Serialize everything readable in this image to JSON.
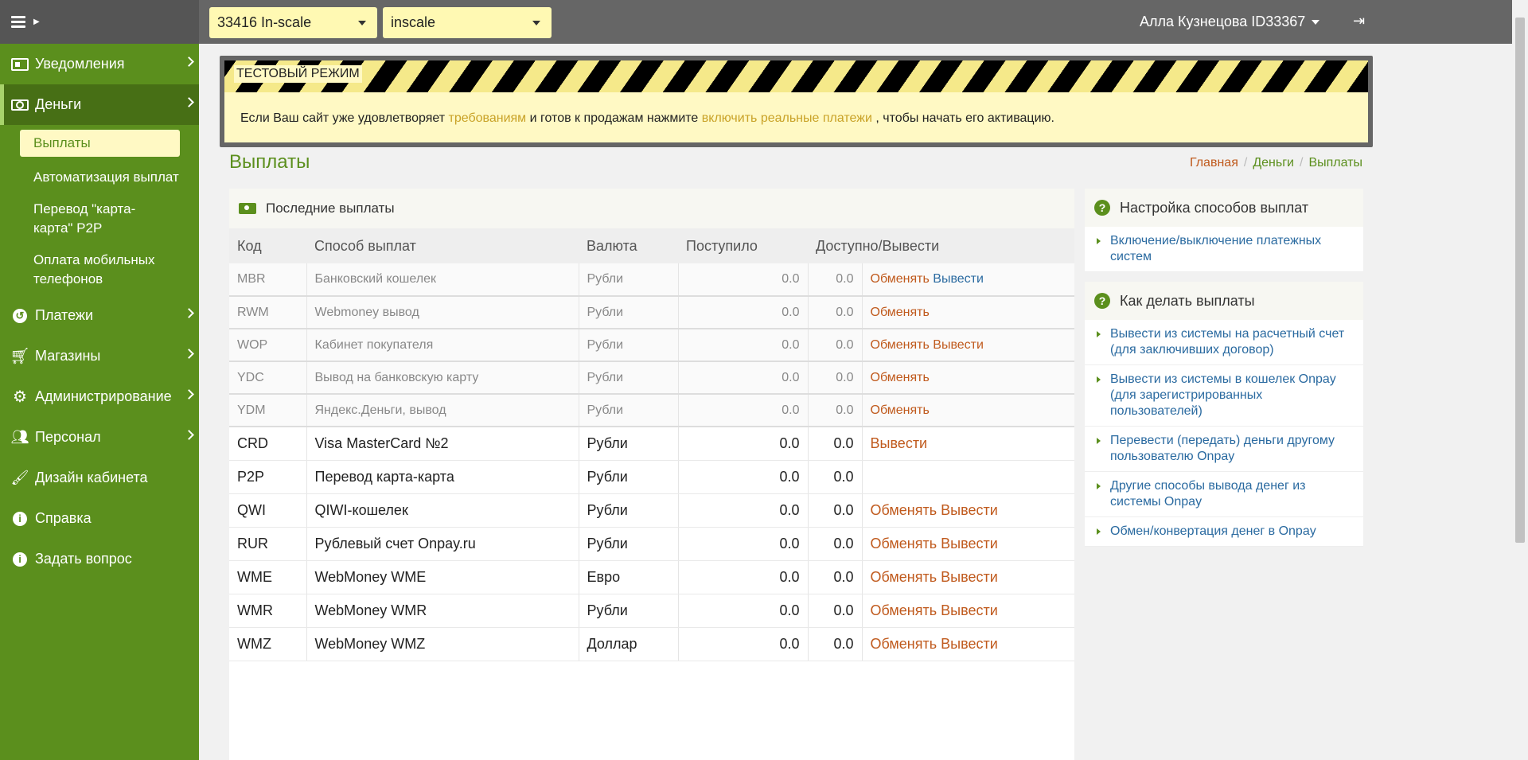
{
  "topbar": {
    "shop_select": "33416 In-scale",
    "site_select": "inscale",
    "user_name": "Алла Кузнецова ID33367"
  },
  "sidebar": {
    "items": [
      {
        "label": "Уведомления",
        "icon": "newspaper-icon"
      },
      {
        "label": "Деньги",
        "icon": "money-icon"
      },
      {
        "label": "Платежи",
        "icon": "history-icon"
      },
      {
        "label": "Магазины",
        "icon": "cart-icon"
      },
      {
        "label": "Администрирование",
        "icon": "gear-icon"
      },
      {
        "label": "Персонал",
        "icon": "users-icon"
      },
      {
        "label": "Дизайн кабинета",
        "icon": "brush-icon"
      },
      {
        "label": "Справка",
        "icon": "info-icon"
      },
      {
        "label": "Задать вопрос",
        "icon": "info-icon"
      }
    ],
    "money_sub": [
      "Выплаты",
      "Автоматизация выплат",
      "Перевод \"карта-карта\" P2P",
      "Оплата мобильных телефонов"
    ]
  },
  "test_mode": {
    "label": "ТЕСТОВЫЙ РЕЖИМ",
    "text_1": "Если Ваш сайт уже удовлетворяет",
    "link_1": "требованиям",
    "text_2": "и готов к продажам нажмите",
    "link_2": "включить реальные платежи",
    "text_3": ", чтобы начать его активацию."
  },
  "page": {
    "title": "Выплаты",
    "breadcrumb": [
      "Главная",
      "Деньги",
      "Выплаты"
    ]
  },
  "payouts": {
    "title": "Последние выплаты",
    "columns": [
      "Код",
      "Способ выплат",
      "Валюта",
      "Поступило",
      "Доступно/Вывести"
    ],
    "exchange_label": "Обменять",
    "withdraw_label": "Вывести",
    "rows": [
      {
        "code": "MBR",
        "method": "Банковский кошелек",
        "currency": "Рубли",
        "received": "0.0",
        "available": "0.0",
        "exchange": true,
        "withdraw": true,
        "dim": true,
        "withdraw_blue": true
      },
      {
        "code": "RWM",
        "method": "Webmoney вывод",
        "currency": "Рубли",
        "received": "0.0",
        "available": "0.0",
        "exchange": true,
        "withdraw": false,
        "dim": true
      },
      {
        "code": "WOP",
        "method": "Кабинет покупателя",
        "currency": "Рубли",
        "received": "0.0",
        "available": "0.0",
        "exchange": true,
        "withdraw": true,
        "dim": true
      },
      {
        "code": "YDC",
        "method": "Вывод на банковскую карту",
        "currency": "Рубли",
        "received": "0.0",
        "available": "0.0",
        "exchange": true,
        "withdraw": false,
        "dim": true
      },
      {
        "code": "YDM",
        "method": "Яндекс.Деньги, вывод",
        "currency": "Рубли",
        "received": "0.0",
        "available": "0.0",
        "exchange": true,
        "withdraw": false,
        "dim": true
      },
      {
        "code": "CRD",
        "method": "Visa MasterCard №2",
        "currency": "Рубли",
        "received": "0.0",
        "available": "0.0",
        "exchange": false,
        "withdraw": true,
        "dim": false
      },
      {
        "code": "P2P",
        "method": "Перевод карта-карта",
        "currency": "Рубли",
        "received": "0.0",
        "available": "0.0",
        "exchange": false,
        "withdraw": false,
        "dim": false
      },
      {
        "code": "QWI",
        "method": "QIWI-кошелек",
        "currency": "Рубли",
        "received": "0.0",
        "available": "0.0",
        "exchange": true,
        "withdraw": true,
        "dim": false
      },
      {
        "code": "RUR",
        "method": "Рублевый счет Onpay.ru",
        "currency": "Рубли",
        "received": "0.0",
        "available": "0.0",
        "exchange": true,
        "withdraw": true,
        "dim": false
      },
      {
        "code": "WME",
        "method": "WebMoney WME",
        "currency": "Евро",
        "received": "0.0",
        "available": "0.0",
        "exchange": true,
        "withdraw": true,
        "dim": false
      },
      {
        "code": "WMR",
        "method": "WebMoney WMR",
        "currency": "Рубли",
        "received": "0.0",
        "available": "0.0",
        "exchange": true,
        "withdraw": true,
        "dim": false
      },
      {
        "code": "WMZ",
        "method": "WebMoney WMZ",
        "currency": "Доллар",
        "received": "0.0",
        "available": "0.0",
        "exchange": true,
        "withdraw": true,
        "dim": false
      }
    ]
  },
  "widgets": {
    "settings": {
      "title": "Настройка способов выплат",
      "items": [
        "Включение/выключение платежных систем"
      ]
    },
    "howto": {
      "title": "Как делать выплаты",
      "items": [
        "Вывести из системы на расчетный счет (для заключивших договор)",
        "Вывести из системы в кошелек Onpay (для зарегистрированных пользователей)",
        "Перевести (передать) деньги другому пользователю Onpay",
        "Другие способы вывода денег из системы Onpay",
        "Обмен/конвертация денег в Onpay"
      ]
    }
  },
  "colors": {
    "sidebar": "#5b8f1d",
    "accent_orange": "#c05a1d",
    "link_blue": "#2a6aa0",
    "highlight": "#fff9c4"
  }
}
